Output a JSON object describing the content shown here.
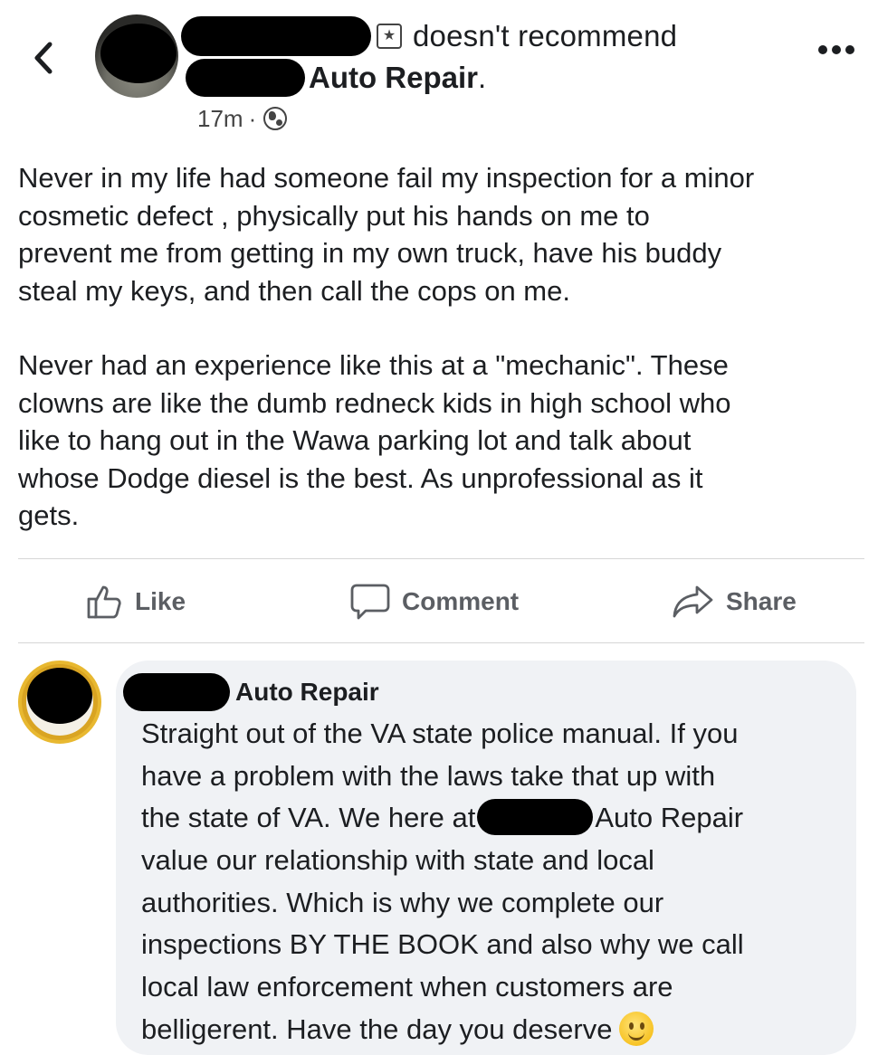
{
  "post": {
    "action_text": "doesn't recommend",
    "page_name": "Auto Repair",
    "page_name_suffix": ".",
    "timestamp": "17m",
    "separator": "·",
    "privacy_icon": "globe-icon",
    "body_paragraphs": [
      "Never in my life had someone fail my inspection for a minor\ncosmetic defect , physically put his hands on me to\nprevent me from getting in my own truck, have his buddy\nsteal my keys, and then call the cops on me.",
      "Never had an experience like this at a \"mechanic\". These\nclowns are like the dumb redneck kids in high school who\nlike to hang out in the Wawa parking lot and talk about\nwhose Dodge diesel is the best. As unprofessional as it\ngets."
    ]
  },
  "actions": {
    "like": "Like",
    "comment": "Comment",
    "share": "Share"
  },
  "comment": {
    "author_suffix": "Auto Repair",
    "lines": {
      "l1": "Straight out of the VA state police manual. If you",
      "l2": "have a problem with the laws take that up with",
      "l3_before": "the state of VA. We here at",
      "l3_after": "Auto Repair",
      "l4": "value our relationship with state and local",
      "l5": "authorities. Which is why we complete our",
      "l6": "inspections BY THE BOOK and also why we call",
      "l7": "local law enforcement when customers are",
      "l8": "belligerent. Have the day you deserve"
    },
    "emoji": "slightly-smiling-face"
  },
  "colors": {
    "text": "#1c1e21",
    "secondary": "#5b5e63",
    "bubble": "#f0f2f5",
    "divider": "#d6d6d6"
  }
}
